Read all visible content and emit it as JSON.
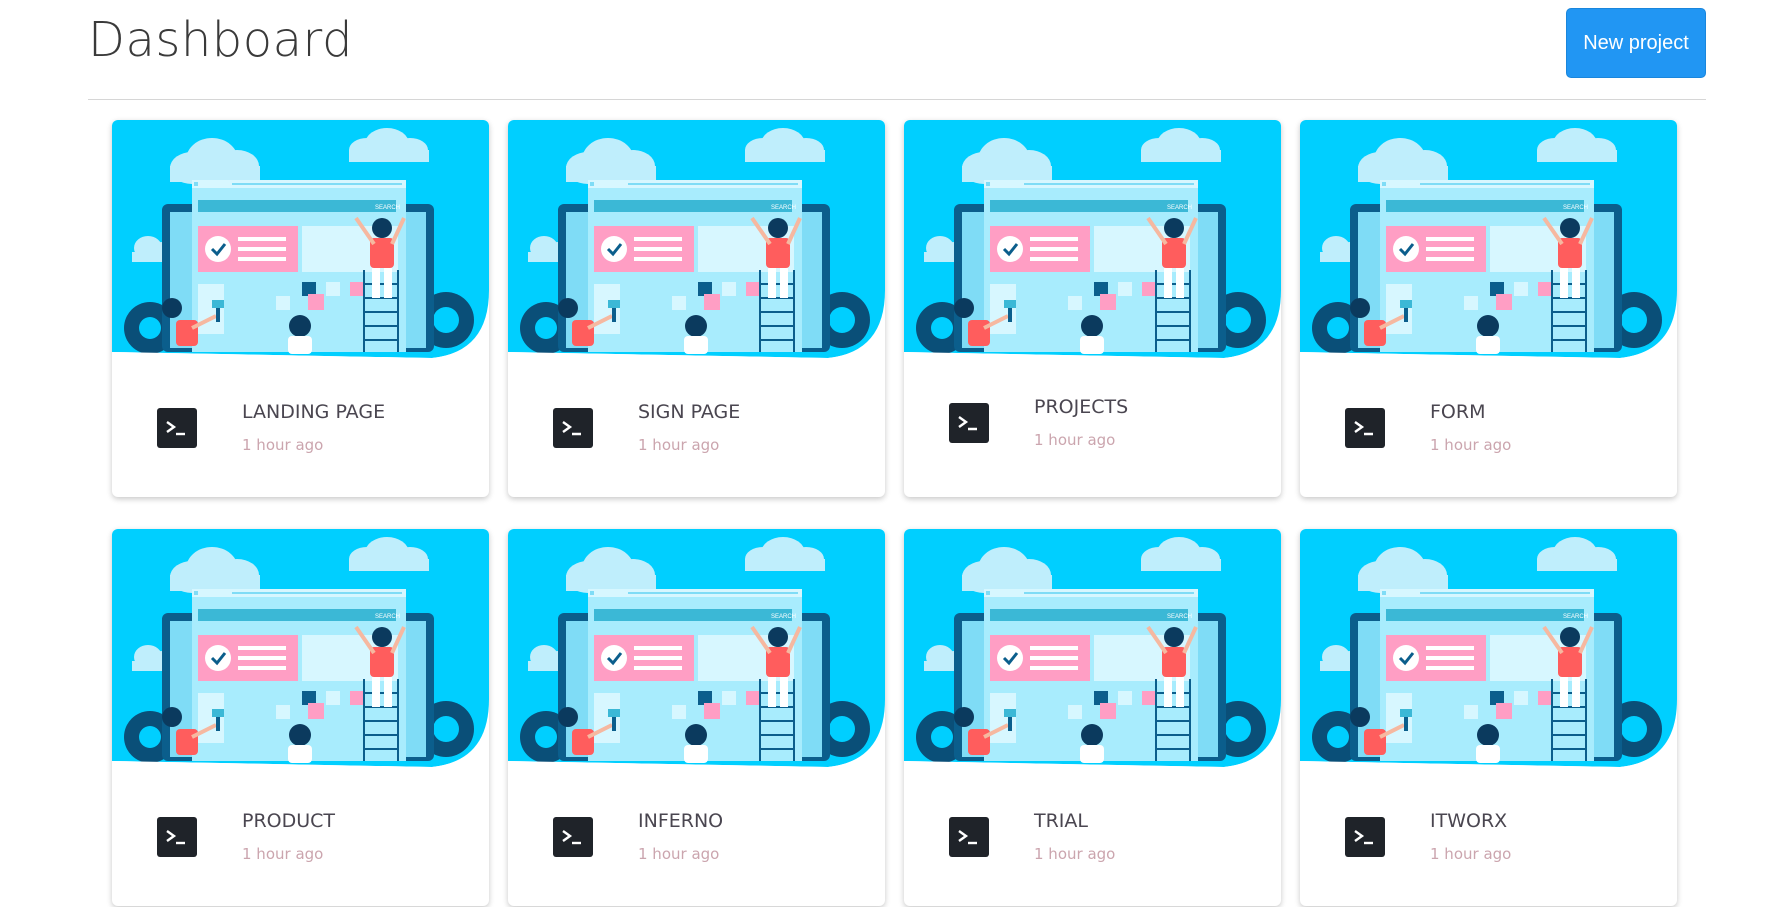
{
  "header": {
    "title": "Dashboard",
    "new_project_label": "New project"
  },
  "illustration": {
    "search_text": "SEARCH",
    "colors": {
      "sky": "#00cfff",
      "cloud": "#bfeefc",
      "browser": "#a8ecfd",
      "frame": "#0b5e8c",
      "pink": "#ff9ec4",
      "person_shirt": "#ff5d5d",
      "gear": "#0a4f78"
    }
  },
  "projects": [
    {
      "title": "LANDING PAGE",
      "time": "1 hour ago",
      "icon": "terminal-icon"
    },
    {
      "title": "SIGN PAGE",
      "time": "1 hour ago",
      "icon": "terminal-icon"
    },
    {
      "title": "PROJECTS",
      "time": "1 hour ago",
      "icon": "terminal-icon"
    },
    {
      "title": "FORM",
      "time": "1 hour ago",
      "icon": "terminal-icon"
    },
    {
      "title": "PRODUCT",
      "time": "1 hour ago",
      "icon": "terminal-icon"
    },
    {
      "title": "INFERNO",
      "time": "1 hour ago",
      "icon": "terminal-icon"
    },
    {
      "title": "TRIAL",
      "time": "1 hour ago",
      "icon": "terminal-icon"
    },
    {
      "title": "ITWORX",
      "time": "1 hour ago",
      "icon": "terminal-icon"
    }
  ]
}
